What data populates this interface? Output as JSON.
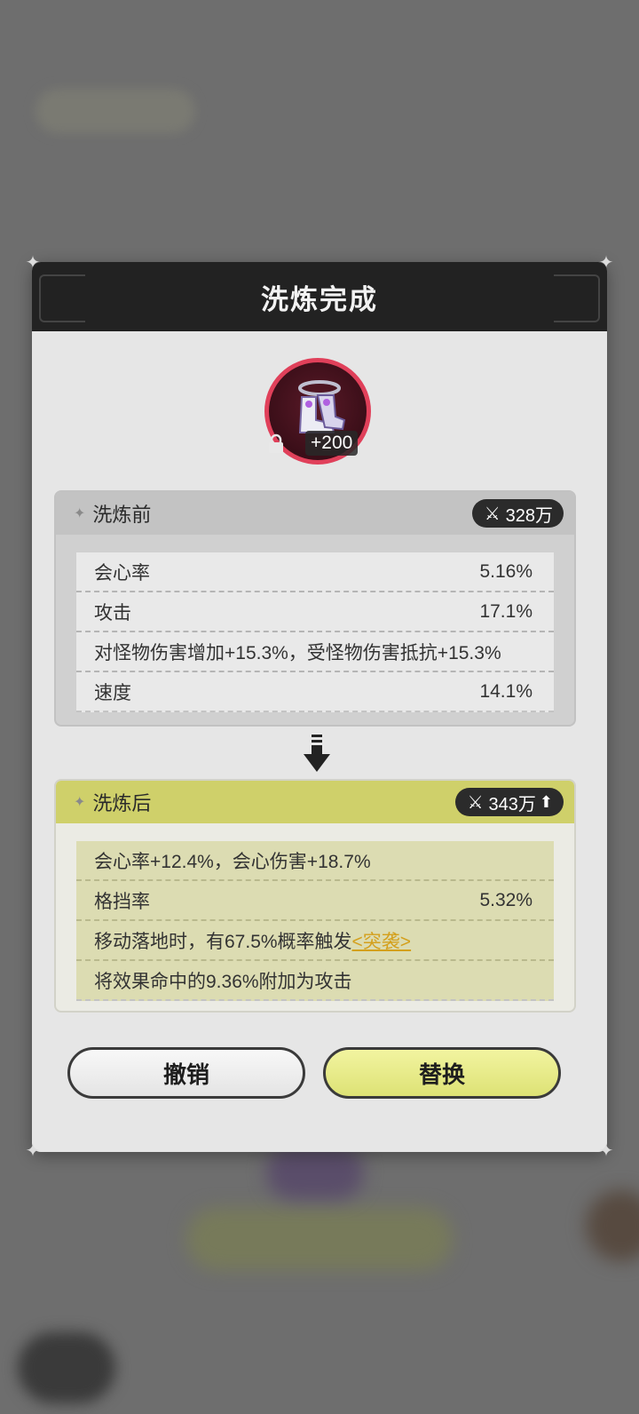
{
  "dialog": {
    "title": "洗炼完成"
  },
  "item": {
    "enhance_level": "+200",
    "locked": true
  },
  "before": {
    "label": "洗炼前",
    "power": "328万",
    "stats": [
      {
        "name": "会心率",
        "value": "5.16%"
      },
      {
        "name": "攻击",
        "value": "17.1%"
      },
      {
        "name": "对怪物伤害增加+15.3%，受怪物伤害抵抗+15.3%",
        "value": ""
      },
      {
        "name": "速度",
        "value": "14.1%"
      }
    ]
  },
  "after": {
    "label": "洗炼后",
    "power": "343万",
    "stats": [
      {
        "name": "会心率+12.4%，会心伤害+18.7%",
        "value": ""
      },
      {
        "name": "格挡率",
        "value": "5.32%"
      },
      {
        "name": "移动落地时，有67.5%概率触发",
        "link": "<突袭>",
        "value": ""
      },
      {
        "name": "将效果命中的9.36%附加为攻击",
        "value": ""
      }
    ]
  },
  "buttons": {
    "cancel": "撤销",
    "replace": "替换"
  },
  "colors": {
    "header_bg": "#222222",
    "after_accent": "#cfd06a",
    "ring": "#e0405a",
    "link": "#d4a01c"
  }
}
